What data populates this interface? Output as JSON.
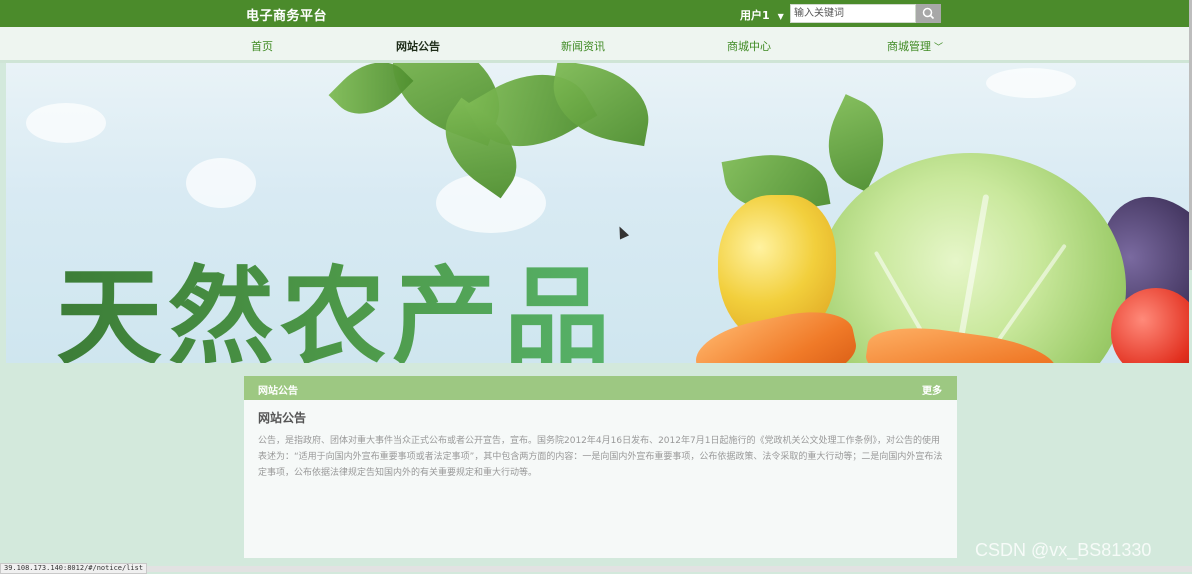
{
  "header": {
    "brand": "电子商务平台",
    "user_label": "用户1",
    "search_placeholder": "输入关键词",
    "search_icon": "search-icon"
  },
  "nav": {
    "items": [
      {
        "label": "首页"
      },
      {
        "label": "网站公告",
        "active": true
      },
      {
        "label": "新闻资讯"
      },
      {
        "label": "商城中心"
      },
      {
        "label": "商城管理",
        "has_dropdown": true
      }
    ]
  },
  "banner": {
    "title": "天然农产品"
  },
  "notice_panel": {
    "header_title": "网站公告",
    "more_label": "更多",
    "title": "网站公告",
    "body": "公告，是指政府、团体对重大事件当众正式公布或者公开宣告，宣布。国务院2012年4月16日发布、2012年7月1日起施行的《党政机关公文处理工作条例》，对公告的使用表述为：“适用于向国内外宣布重要事项或者法定事项”，其中包含两方面的内容：一是向国内外宣布重要事项，公布依据政策、法令采取的重大行动等；二是向国内外宣布法定事项，公布依据法律规定告知国内外的有关重要规定和重大行动等。"
  },
  "status_url": "39.108.173.140:8012/#/notice/list",
  "watermark": "CSDN @vx_BS81330",
  "colors": {
    "topbar": "#4b8b2b",
    "nav_text": "#3f8a23",
    "panel_header": "#9dc882",
    "page_bg": "#d3e9dc"
  }
}
